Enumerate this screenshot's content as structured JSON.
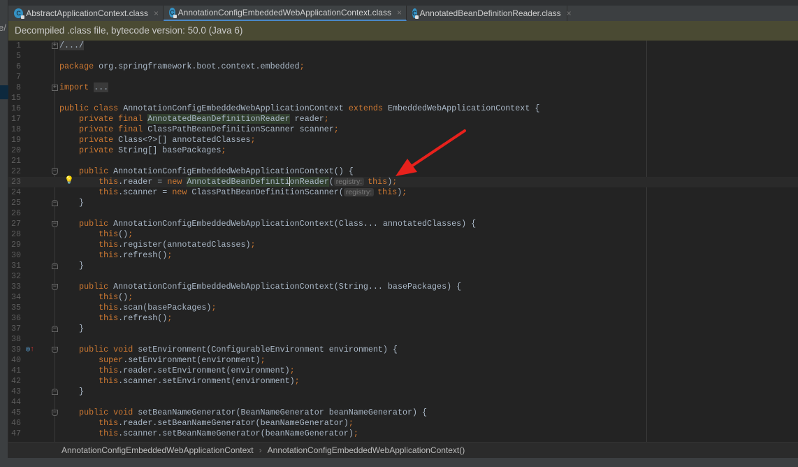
{
  "left_panel": {
    "fragment": "e/"
  },
  "tabs": [
    {
      "label": "AbstractApplicationContext.class",
      "icon": "class-icon",
      "active": false
    },
    {
      "label": "AnnotationConfigEmbeddedWebApplicationContext.class",
      "icon": "class-icon",
      "active": true
    },
    {
      "label": "AnnotatedBeanDefinitionReader.class",
      "icon": "class-icon",
      "active": false
    }
  ],
  "tab_close": "×",
  "class_icon_letter": "C",
  "banner": "Decompiled .class file, bytecode version: 50.0 (Java 6)",
  "colors": {
    "keyword": "#cc7832",
    "text": "#a9b7c6",
    "banner": "#4a4a33",
    "accent": "#4a88c7",
    "arrow": "#e8211c"
  },
  "lines": [
    {
      "n": "1",
      "fold": "plus",
      "segs": [
        [
          "f",
          "/.../"
        ]
      ]
    },
    {
      "n": "5",
      "segs": []
    },
    {
      "n": "6",
      "segs": [
        [
          "k",
          "package "
        ],
        [
          "t",
          "org.springframework.boot.context.embedded"
        ],
        [
          "k",
          ";"
        ]
      ]
    },
    {
      "n": "7",
      "segs": []
    },
    {
      "n": "8",
      "fold": "plus",
      "segs": [
        [
          "k",
          "import "
        ],
        [
          "f",
          "..."
        ]
      ]
    },
    {
      "n": "15",
      "segs": []
    },
    {
      "n": "16",
      "segs": [
        [
          "k",
          "public class "
        ],
        [
          "t",
          "AnnotationConfigEmbeddedWebApplicationContext "
        ],
        [
          "k",
          "extends "
        ],
        [
          "t",
          "EmbeddedWebApplicationContext {"
        ]
      ]
    },
    {
      "n": "17",
      "segs": [
        [
          "k",
          "    private final "
        ],
        [
          "h",
          "AnnotatedBeanDefinitionReader"
        ],
        [
          "t",
          " reader"
        ],
        [
          "k",
          ";"
        ]
      ]
    },
    {
      "n": "18",
      "segs": [
        [
          "k",
          "    private final "
        ],
        [
          "t",
          "ClassPathBeanDefinitionScanner scanner"
        ],
        [
          "k",
          ";"
        ]
      ]
    },
    {
      "n": "19",
      "segs": [
        [
          "k",
          "    private "
        ],
        [
          "t",
          "Class<?>[] annotatedClasses"
        ],
        [
          "k",
          ";"
        ]
      ]
    },
    {
      "n": "20",
      "segs": [
        [
          "k",
          "    private "
        ],
        [
          "t",
          "String[] basePackages"
        ],
        [
          "k",
          ";"
        ]
      ]
    },
    {
      "n": "21",
      "segs": []
    },
    {
      "n": "22",
      "fold": "open",
      "segs": [
        [
          "k",
          "    public "
        ],
        [
          "t",
          "AnnotationConfigEmbeddedWebApplicationContext() {"
        ]
      ]
    },
    {
      "n": "23",
      "bulb": true,
      "current": true,
      "segs": [
        [
          "k",
          "        this"
        ],
        [
          "t",
          ".reader = "
        ],
        [
          "k",
          "new "
        ],
        [
          "h",
          "AnnotatedBeanDefiniti"
        ],
        [
          "caret",
          ""
        ],
        [
          "h",
          "onReader"
        ],
        [
          "t",
          "("
        ],
        [
          "p",
          "registry:"
        ],
        [
          "k",
          "this"
        ],
        [
          "t",
          ")"
        ],
        [
          "k",
          ";"
        ]
      ]
    },
    {
      "n": "24",
      "segs": [
        [
          "k",
          "        this"
        ],
        [
          "t",
          ".scanner = "
        ],
        [
          "k",
          "new "
        ],
        [
          "t",
          "ClassPathBeanDefinitionScanner("
        ],
        [
          "p",
          "registry:"
        ],
        [
          "k",
          "this"
        ],
        [
          "t",
          ")"
        ],
        [
          "k",
          ";"
        ]
      ]
    },
    {
      "n": "25",
      "fold": "close",
      "segs": [
        [
          "t",
          "    }"
        ]
      ]
    },
    {
      "n": "26",
      "segs": []
    },
    {
      "n": "27",
      "fold": "open",
      "segs": [
        [
          "k",
          "    public "
        ],
        [
          "t",
          "AnnotationConfigEmbeddedWebApplicationContext(Class... annotatedClasses) {"
        ]
      ]
    },
    {
      "n": "28",
      "segs": [
        [
          "k",
          "        this"
        ],
        [
          "t",
          "()"
        ],
        [
          "k",
          ";"
        ]
      ]
    },
    {
      "n": "29",
      "segs": [
        [
          "k",
          "        this"
        ],
        [
          "t",
          ".register(annotatedClasses)"
        ],
        [
          "k",
          ";"
        ]
      ]
    },
    {
      "n": "30",
      "segs": [
        [
          "k",
          "        this"
        ],
        [
          "t",
          ".refresh()"
        ],
        [
          "k",
          ";"
        ]
      ]
    },
    {
      "n": "31",
      "fold": "close",
      "segs": [
        [
          "t",
          "    }"
        ]
      ]
    },
    {
      "n": "32",
      "segs": []
    },
    {
      "n": "33",
      "fold": "open",
      "segs": [
        [
          "k",
          "    public "
        ],
        [
          "t",
          "AnnotationConfigEmbeddedWebApplicationContext(String... basePackages) {"
        ]
      ]
    },
    {
      "n": "34",
      "segs": [
        [
          "k",
          "        this"
        ],
        [
          "t",
          "()"
        ],
        [
          "k",
          ";"
        ]
      ]
    },
    {
      "n": "35",
      "segs": [
        [
          "k",
          "        this"
        ],
        [
          "t",
          ".scan(basePackages)"
        ],
        [
          "k",
          ";"
        ]
      ]
    },
    {
      "n": "36",
      "segs": [
        [
          "k",
          "        this"
        ],
        [
          "t",
          ".refresh()"
        ],
        [
          "k",
          ";"
        ]
      ]
    },
    {
      "n": "37",
      "fold": "close",
      "segs": [
        [
          "t",
          "    }"
        ]
      ]
    },
    {
      "n": "38",
      "segs": []
    },
    {
      "n": "39",
      "fold": "open",
      "override": true,
      "segs": [
        [
          "k",
          "    public void "
        ],
        [
          "t",
          "setEnvironment(ConfigurableEnvironment environment) {"
        ]
      ]
    },
    {
      "n": "40",
      "segs": [
        [
          "k",
          "        super"
        ],
        [
          "t",
          ".setEnvironment(environment)"
        ],
        [
          "k",
          ";"
        ]
      ]
    },
    {
      "n": "41",
      "segs": [
        [
          "k",
          "        this"
        ],
        [
          "t",
          ".reader.setEnvironment(environment)"
        ],
        [
          "k",
          ";"
        ]
      ]
    },
    {
      "n": "42",
      "segs": [
        [
          "k",
          "        this"
        ],
        [
          "t",
          ".scanner.setEnvironment(environment)"
        ],
        [
          "k",
          ";"
        ]
      ]
    },
    {
      "n": "43",
      "fold": "close",
      "segs": [
        [
          "t",
          "    }"
        ]
      ]
    },
    {
      "n": "44",
      "segs": []
    },
    {
      "n": "45",
      "fold": "open",
      "segs": [
        [
          "k",
          "    public void "
        ],
        [
          "t",
          "setBeanNameGenerator(BeanNameGenerator beanNameGenerator) {"
        ]
      ]
    },
    {
      "n": "46",
      "segs": [
        [
          "k",
          "        this"
        ],
        [
          "t",
          ".reader.setBeanNameGenerator(beanNameGenerator)"
        ],
        [
          "k",
          ";"
        ]
      ]
    },
    {
      "n": "47",
      "segs": [
        [
          "k",
          "        this"
        ],
        [
          "t",
          ".scanner.setBeanNameGenerator(beanNameGenerator)"
        ],
        [
          "k",
          ";"
        ]
      ]
    }
  ],
  "breadcrumbs": [
    "AnnotationConfigEmbeddedWebApplicationContext",
    "AnnotationConfigEmbeddedWebApplicationContext()"
  ],
  "breadcrumb_sep": "›"
}
